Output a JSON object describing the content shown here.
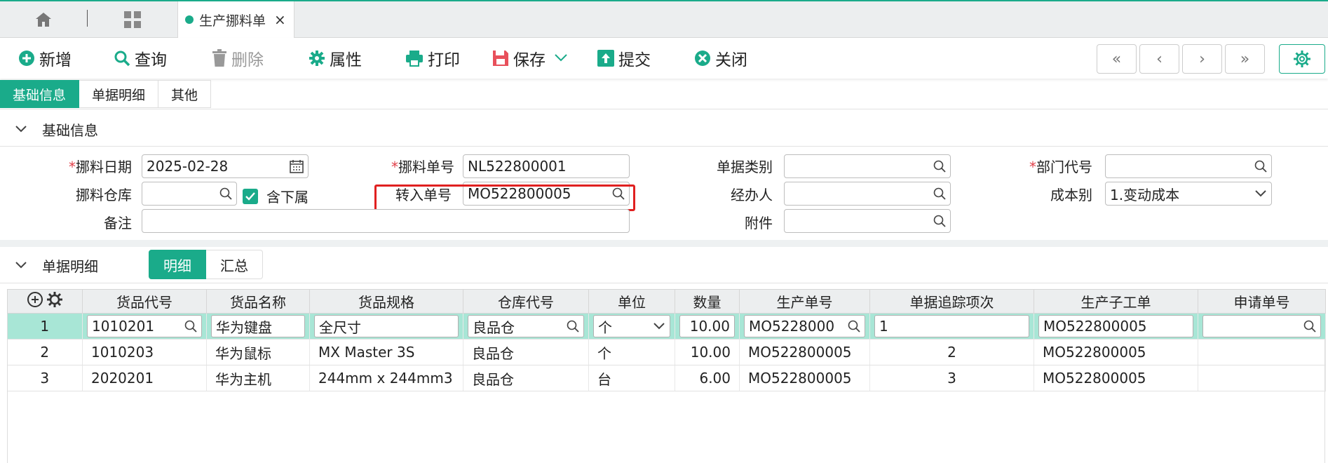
{
  "tabs": {
    "home": "home-icon",
    "grid": "apps-grid-icon",
    "doc_label": "生产挪料单",
    "close": "×"
  },
  "toolbar": {
    "new": "新增",
    "query": "查询",
    "delete": "删除",
    "props": "属性",
    "print": "打印",
    "save": "保存",
    "submit": "提交",
    "close": "关闭"
  },
  "nav": {
    "first": "«",
    "prev": "‹",
    "next": "›",
    "last": "»"
  },
  "section_tabs": [
    "基础信息",
    "单据明细",
    "其他"
  ],
  "basic": {
    "title": "基础信息",
    "date_label": "挪料日期",
    "date_value": "2025-02-28",
    "no_label": "挪料单号",
    "no_value": "NL522800001",
    "doctype_label": "单据类别",
    "doctype_value": "",
    "dept_label": "部门代号",
    "dept_value": "",
    "wh_label": "挪料仓库",
    "wh_value": "",
    "include_sub_label": "含下属",
    "transfer_label": "转入单号",
    "transfer_value": "MO522800005",
    "handler_label": "经办人",
    "handler_value": "",
    "cost_label": "成本别",
    "cost_value": "1.变动成本",
    "remark_label": "备注",
    "remark_value": "",
    "attach_label": "附件",
    "attach_value": ""
  },
  "detail": {
    "title": "单据明细",
    "subtabs": [
      "明细",
      "汇总"
    ],
    "columns": [
      "货品代号",
      "货品名称",
      "货品规格",
      "仓库代号",
      "单位",
      "数量",
      "生产单号",
      "单据追踪项次",
      "生产子工单",
      "申请单号"
    ],
    "rows": [
      {
        "idx": "1",
        "code": "1010201",
        "name": "华为键盘",
        "spec": "全尺寸",
        "wh": "良品仓",
        "unit": "个",
        "qty": "10.00",
        "mo": "MO5228000",
        "trace": "1",
        "sub": "MO522800005",
        "req": ""
      },
      {
        "idx": "2",
        "code": "1010203",
        "name": "华为鼠标",
        "spec": "MX Master 3S",
        "wh": "良品仓",
        "unit": "个",
        "qty": "10.00",
        "mo": "MO522800005",
        "trace": "2",
        "sub": "MO522800005",
        "req": ""
      },
      {
        "idx": "3",
        "code": "2020201",
        "name": "华为主机",
        "spec": "244mm x 244mm3",
        "wh": "良品仓",
        "unit": "台",
        "qty": "6.00",
        "mo": "MO522800005",
        "trace": "3",
        "sub": "MO522800005",
        "req": ""
      }
    ]
  },
  "colors": {
    "accent": "#1aab8a",
    "selected_row": "#a8e6d6",
    "required": "#e0404a",
    "highlight": "#e02020"
  }
}
